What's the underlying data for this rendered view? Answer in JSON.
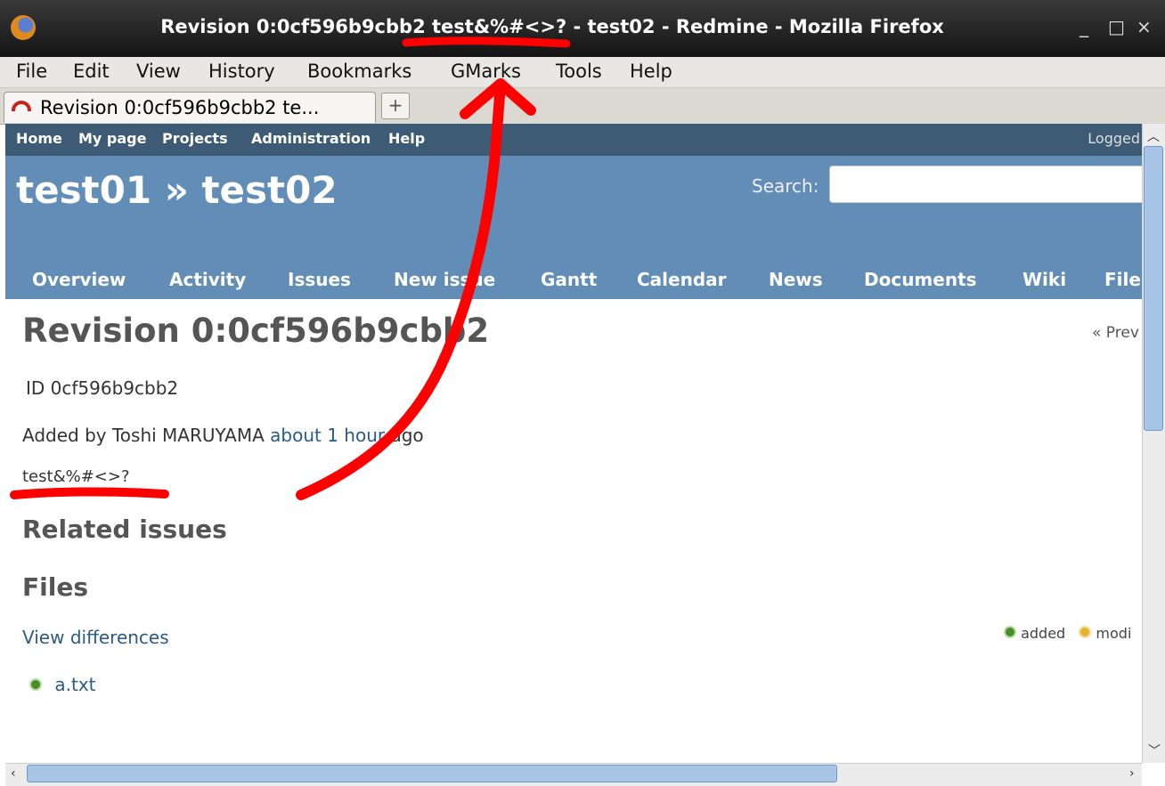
{
  "window": {
    "title": "Revision 0:0cf596b9cbb2 test&%#<>? - test02 - Redmine - Mozilla Firefox",
    "controls": [
      "_",
      "□",
      "×"
    ]
  },
  "menubar": [
    {
      "label": "File"
    },
    {
      "label": "Edit"
    },
    {
      "label": "View"
    },
    {
      "label": "History"
    },
    {
      "label": "Bookmarks"
    },
    {
      "label": "GMarks"
    },
    {
      "label": "Tools"
    },
    {
      "label": "Help"
    }
  ],
  "tab": {
    "label": "Revision 0:0cf596b9cbb2 te...",
    "new_tab": "+"
  },
  "topmenu": {
    "links": [
      "Home",
      "My page",
      "Projects",
      "Administration",
      "Help"
    ],
    "logged": "Logged"
  },
  "header": {
    "title": "test01 » test02",
    "search_label": "Search:",
    "search_value": ""
  },
  "project_tabs": [
    "Overview",
    "Activity",
    "Issues",
    "New issue",
    "Gantt",
    "Calendar",
    "News",
    "Documents",
    "Wiki",
    "File"
  ],
  "content": {
    "heading": "Revision 0:0cf596b9cbb2",
    "prev": "« Prev",
    "id_line": "ID 0cf596b9cbb2",
    "added_by_prefix": "Added by Toshi MARUYAMA",
    "added_by_link": "about 1 hour",
    "added_by_suffix": "ago",
    "message": "test&%#<>?",
    "related_issues": "Related issues",
    "files": "Files",
    "view_differences": "View differences",
    "legend_added": "added",
    "legend_modified": "modi",
    "file_entry": "a.txt"
  },
  "annotation_color": "#ff0000"
}
